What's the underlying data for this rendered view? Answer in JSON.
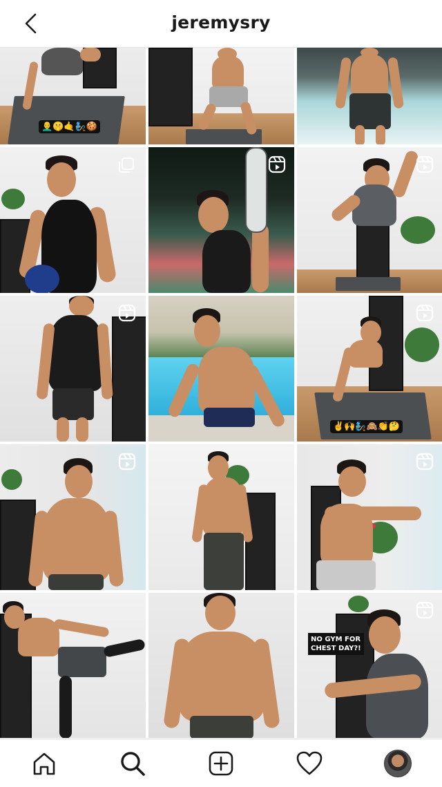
{
  "header": {
    "title": "jeremysry",
    "back_icon": "chevron-left-icon"
  },
  "grid": {
    "tiles": [
      {
        "type": "photo",
        "overlay": "emoji-bar",
        "emoji_text": "👨‍🦲🤫🤙🧞🍪"
      },
      {
        "type": "photo"
      },
      {
        "type": "photo"
      },
      {
        "type": "photo",
        "overlay": "multi-photo-icon"
      },
      {
        "type": "reel",
        "overlay": "reel-icon"
      },
      {
        "type": "reel",
        "overlay": "reel-icon"
      },
      {
        "type": "reel",
        "overlay": "reel-icon"
      },
      {
        "type": "photo"
      },
      {
        "type": "reel",
        "overlay": "reel-icon",
        "emoji_text": "✌️🙌🧞🙈👏🤔"
      },
      {
        "type": "reel",
        "overlay": "reel-icon"
      },
      {
        "type": "photo"
      },
      {
        "type": "reel",
        "overlay": "reel-icon"
      },
      {
        "type": "photo"
      },
      {
        "type": "photo"
      },
      {
        "type": "reel",
        "overlay": "reel-icon",
        "caption": "NO GYM FOR\nCHEST DAY?!"
      }
    ]
  },
  "nav": {
    "items": [
      {
        "name": "home",
        "icon": "home-icon"
      },
      {
        "name": "search",
        "icon": "search-icon"
      },
      {
        "name": "create",
        "icon": "plus-square-icon"
      },
      {
        "name": "activity",
        "icon": "heart-icon"
      },
      {
        "name": "profile",
        "icon": "profile-avatar"
      }
    ]
  },
  "colors": {
    "background": "#ffffff",
    "text": "#1a1a1a",
    "divider": "#e6e6e6"
  }
}
